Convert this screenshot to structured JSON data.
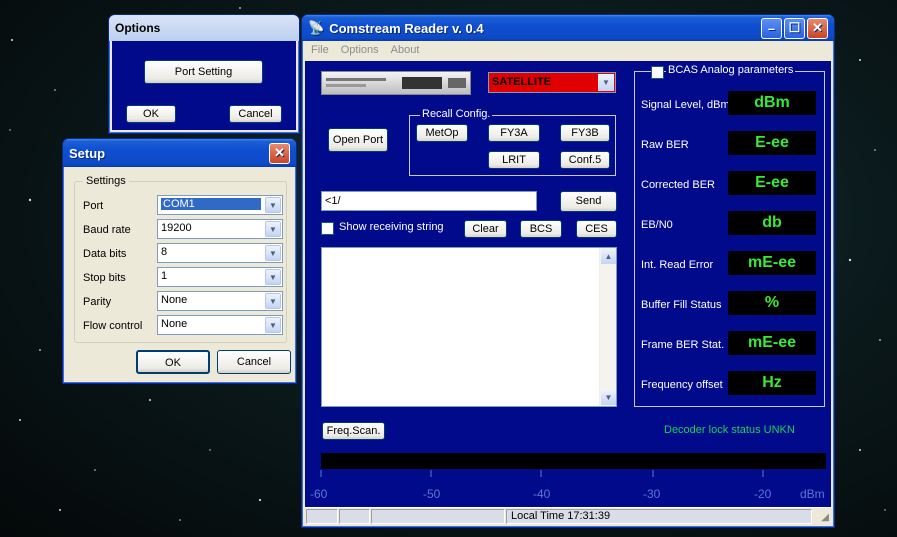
{
  "options_window": {
    "title": "Options",
    "port_setting_label": "Port Setting",
    "ok_label": "OK",
    "cancel_label": "Cancel"
  },
  "setup_window": {
    "title": "Setup",
    "group_label": "Settings",
    "fields": [
      {
        "label": "Port",
        "value": "COM1"
      },
      {
        "label": "Baud rate",
        "value": "19200"
      },
      {
        "label": "Data bits",
        "value": "8"
      },
      {
        "label": "Stop bits",
        "value": "1"
      },
      {
        "label": "Parity",
        "value": "None"
      },
      {
        "label": "Flow control",
        "value": "None"
      }
    ],
    "ok_label": "OK",
    "cancel_label": "Cancel"
  },
  "main_window": {
    "title": "Comstream Reader v. 0.4",
    "menu": [
      "File",
      "Options",
      "About"
    ],
    "mode_select": "SATELLITE",
    "open_port_label": "Open Port",
    "recall_label": "Recall Config.",
    "recall_buttons": [
      "MetOp",
      "FY3A",
      "FY3B",
      "LRIT",
      "Conf.5"
    ],
    "command_value": "<1/",
    "send_label": "Send",
    "show_receiving_label": "Show receiving string",
    "clear_label": "Clear",
    "bcs_label": "BCS",
    "ces_label": "CES",
    "freq_scan_label": "Freq.Scan.",
    "decoder_status": "Decoder lock status UNKN",
    "bcas_label": "BCAS Analog parameters",
    "params": [
      {
        "label": "Signal Level, dBm",
        "value": "dBm"
      },
      {
        "label": "Raw BER",
        "value": "E-ee"
      },
      {
        "label": "Corrected BER",
        "value": "E-ee"
      },
      {
        "label": "EB/N0",
        "value": "db"
      },
      {
        "label": "Int. Read Error",
        "value": "mE-ee"
      },
      {
        "label": "Buffer Fill Status",
        "value": "%"
      },
      {
        "label": "Frame BER Stat.",
        "value": "mE-ee"
      },
      {
        "label": "Frequency offset",
        "value": "Hz"
      }
    ],
    "scale_ticks": [
      "-60",
      "-50",
      "-40",
      "-30",
      "-20"
    ],
    "scale_unit": "dBm",
    "status_time": "Local Time  17:31:39",
    "colors": {
      "panel_bg": "#000a8a",
      "lcd_text": "#39e839",
      "decoder_text": "#19d25a",
      "mode_bg": "#e00000"
    }
  }
}
